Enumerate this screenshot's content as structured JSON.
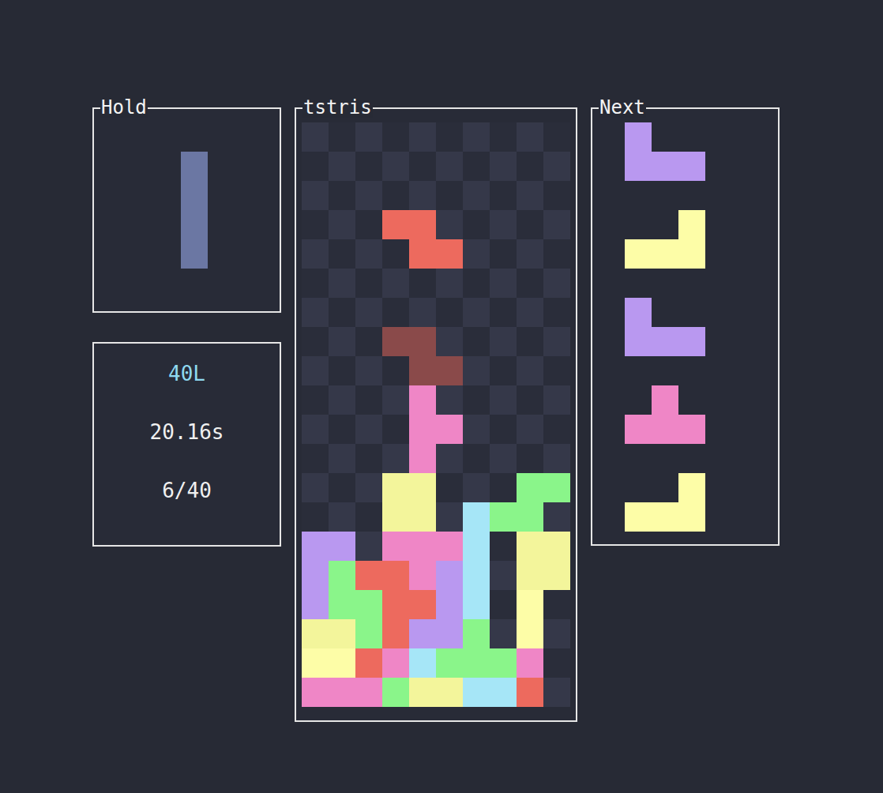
{
  "panels": {
    "hold": "Hold",
    "board": "tstris",
    "next": "Next"
  },
  "hold": {
    "piece": "I",
    "available": false
  },
  "stats": {
    "mode": "40L",
    "time": "20.16s",
    "lines": "6/40"
  },
  "next": [
    "J",
    "L",
    "J",
    "T",
    "L"
  ],
  "colors": {
    "T": "#ef86c6",
    "Z": "#ed6a5e",
    "S": "#8af58a",
    "I": "#a6e6f7",
    "O": "#f3f59b",
    "L": "#fdfda7",
    "J": "#b998f0",
    "g": "#8a4a4a"
  },
  "board": [
    "..........",
    "..........",
    "..........",
    "...ZZ.....",
    "....ZZ....",
    "..........",
    "..........",
    "...gg.....",
    "....gg....",
    "....T.....",
    "....TT....",
    "....T.....",
    "...OO...SS",
    "...OO.ISS.",
    "JJ.TTTI.OO",
    "JSZZTJI.OO",
    "JSSZZJI.L.",
    "OOSZJJS.L.",
    "LLZTISSST.",
    "TTTSOOIIZ."
  ]
}
